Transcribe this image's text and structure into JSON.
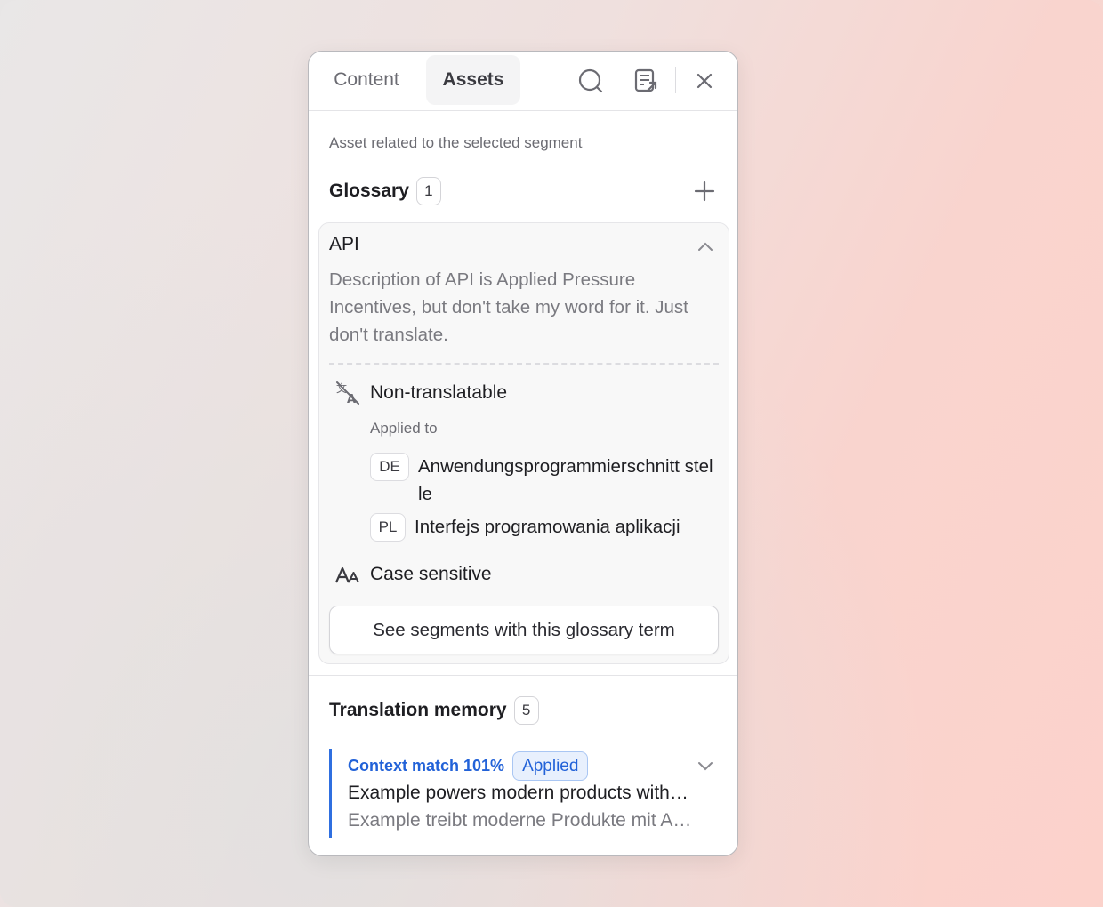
{
  "tabs": [
    {
      "label": "Content",
      "active": false
    },
    {
      "label": "Assets",
      "active": true
    }
  ],
  "header_icons": [
    "search-icon",
    "document-export-icon",
    "close-icon"
  ],
  "subtitle": "Asset related to the selected segment",
  "glossary": {
    "title": "Glossary",
    "count": "1",
    "term": {
      "name": "API",
      "description": "Description of API is Applied Pressure Incentives, but don't take my word for it. Just don't translate.",
      "non_translatable_label": "Non-translatable",
      "applied_to_label": "Applied to",
      "translations": [
        {
          "lang": "DE",
          "text": "Anwendungsprogrammierschnitt stelle"
        },
        {
          "lang": "PL",
          "text": "Interfejs programowania aplikacji"
        }
      ],
      "case_sensitive_label": "Case sensitive",
      "see_segments_label": "See segments with this glossary term"
    }
  },
  "translation_memory": {
    "title": "Translation memory",
    "count": "5",
    "items": [
      {
        "match": "Context match 101%",
        "status": "Applied",
        "source": "Example powers modern products with…",
        "target": "Example treibt moderne Produkte mit A…"
      }
    ]
  },
  "colors": {
    "accent": "#2262d8",
    "applied_bg": "#e8f0fd",
    "panel_bg": "#ffffff",
    "card_bg": "#f8f8f8"
  }
}
